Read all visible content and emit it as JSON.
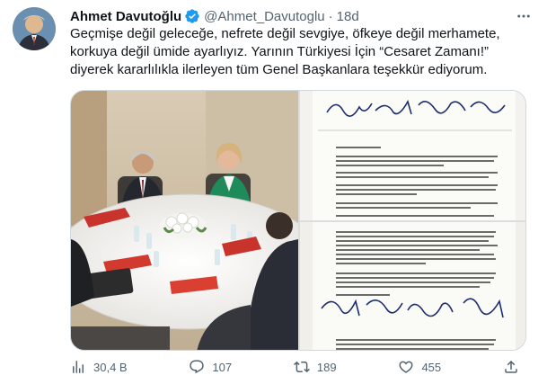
{
  "author": {
    "name": "Ahmet Davutoğlu",
    "handle": "@Ahmet_Davutoglu",
    "time": "18d"
  },
  "tweet": {
    "text": "Geçmişe değil geleceğe, nefrete değil sevgiye, öfkeye değil merhamete,\nkorkuya değil ümide ayarlıyız. Yarının Türkiyesi İçin “Cesaret Zamanı!”\ndiyerek kararlılıkla ilerleyen tüm Genel Başkanlara teşekkür ediyorum."
  },
  "media": {
    "photos": [
      {
        "kind": "meeting-photo"
      },
      {
        "kind": "signed-document-page-1"
      },
      {
        "kind": "signed-document-page-2"
      }
    ]
  },
  "actions": {
    "views": "30,4 B",
    "replies": "107",
    "retweets": "189",
    "likes": "455"
  },
  "colors": {
    "text": "#0f1419",
    "secondary": "#536471",
    "verified": "#1d9bf0",
    "border": "#cfd9de"
  },
  "icons": [
    "verified-badge-icon",
    "more-icon",
    "views-icon",
    "reply-icon",
    "retweet-icon",
    "like-icon",
    "share-icon"
  ]
}
